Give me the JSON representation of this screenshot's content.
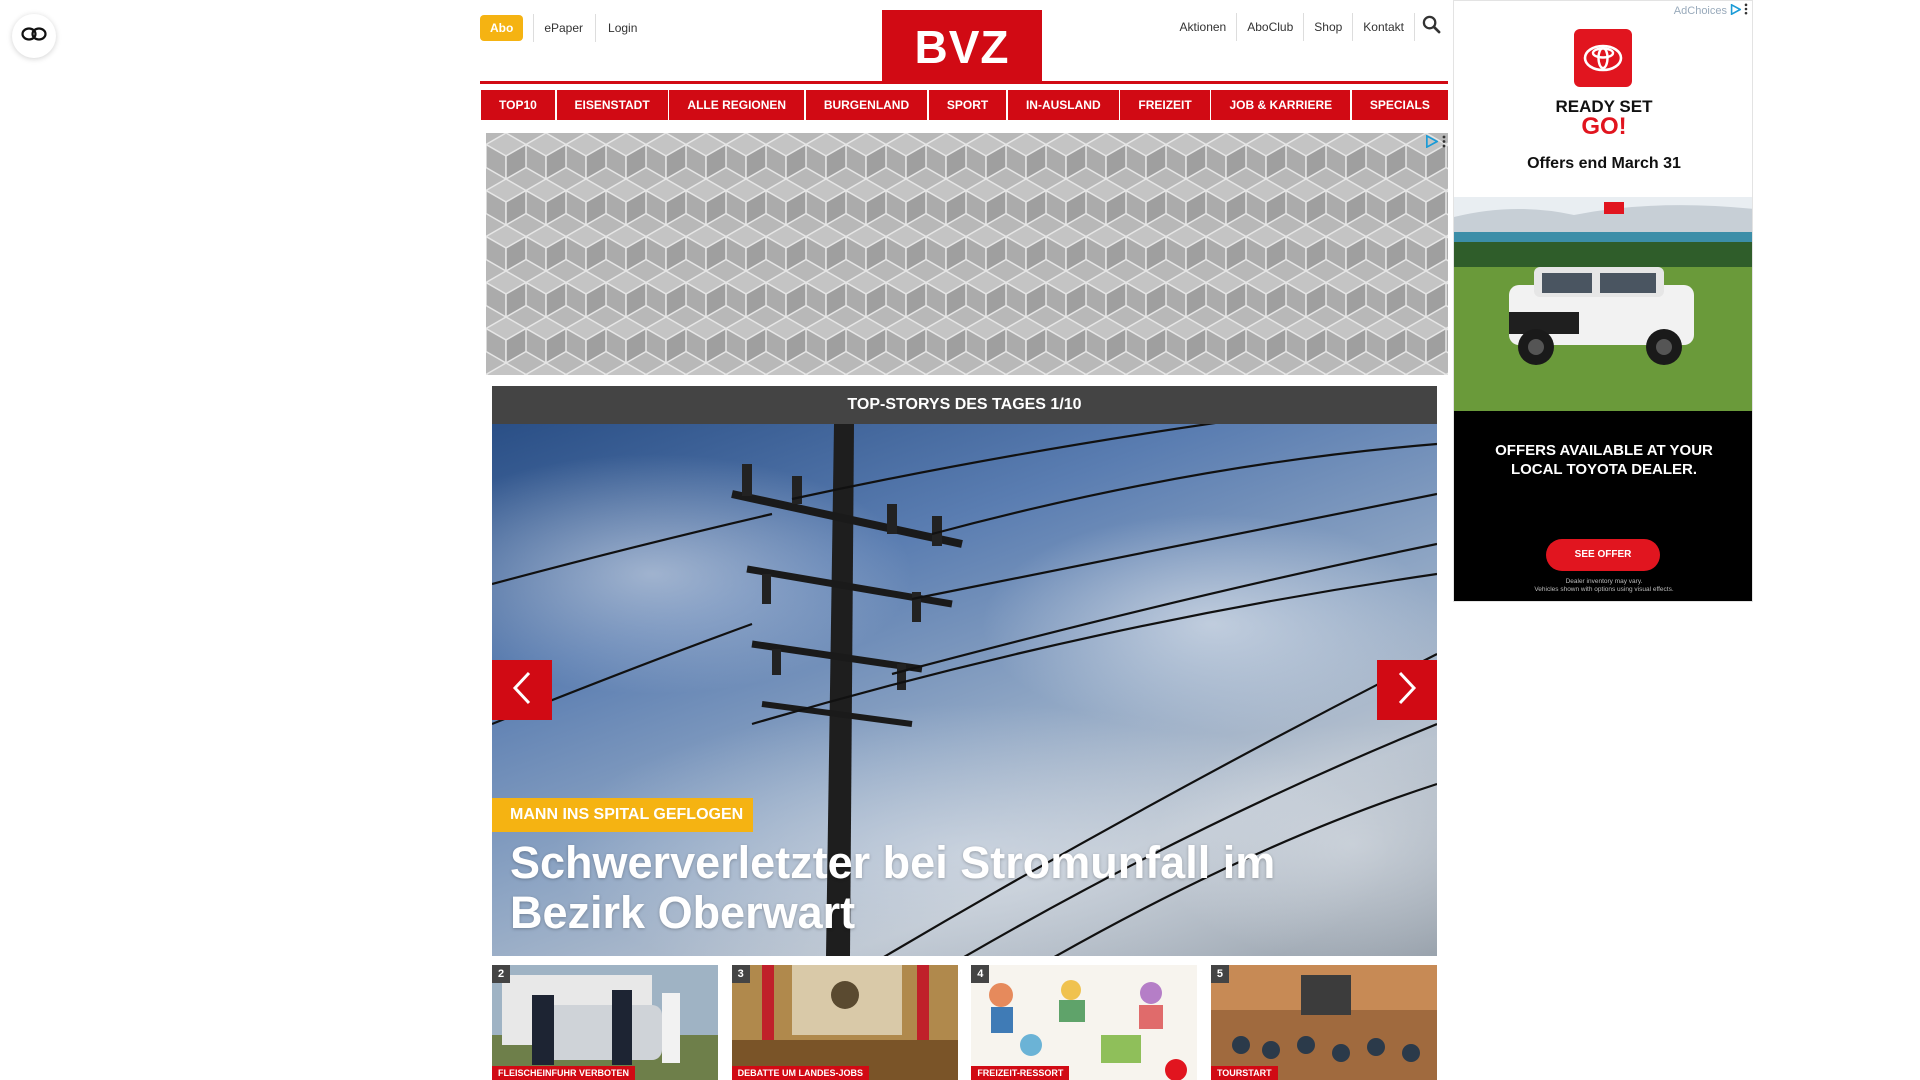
{
  "topbar": {
    "abo_label": "Abo",
    "left_links": [
      "ePaper",
      "Login"
    ],
    "right_links": [
      "Aktionen",
      "AboClub",
      "Shop",
      "Kontakt"
    ]
  },
  "logo": {
    "text": "BVZ"
  },
  "nav": {
    "items": [
      "TOP10",
      "EISENSTADT",
      "ALLE REGIONEN",
      "BURGENLAND",
      "SPORT",
      "IN-AUSLAND",
      "FREIZEIT",
      "JOB & KARRIERE",
      "SPECIALS"
    ]
  },
  "slider": {
    "header": "TOP-STORYS DES TAGES 1/10",
    "kicker": "MANN INS SPITAL GEFLOGEN",
    "headline": "Schwerverletzter bei Stromunfall im Bezirk Oberwart"
  },
  "thumbs": [
    {
      "num": "2",
      "tag": "FLEISCHEINFUHR VERBOTEN"
    },
    {
      "num": "3",
      "tag": "DEBATTE UM LANDES-JOBS"
    },
    {
      "num": "4",
      "tag": "FREIZEIT-RESSORT"
    },
    {
      "num": "5",
      "tag": "TOURSTART"
    }
  ],
  "side_ad": {
    "adchoices": "AdChoices",
    "ready": "READY SET",
    "go": "GO!",
    "offers_end": "Offers end March 31",
    "offers_local": "OFFERS AVAILABLE AT YOUR LOCAL TOYOTA DEALER.",
    "cta": "SEE OFFER",
    "disclaimer_1": "Dealer inventory may vary.",
    "disclaimer_2": "Vehicles shown with options using visual effects."
  },
  "colors": {
    "brand_red": "#d10a14",
    "accent_yellow": "#f5b312",
    "toyota_red": "#e1151f"
  },
  "icons": [
    "reader-mode-icon",
    "search-icon",
    "chevron-left-icon",
    "chevron-right-icon",
    "ad-choices-icon",
    "ad-menu-icon",
    "toyota-logo-icon",
    "instagram-icon"
  ]
}
